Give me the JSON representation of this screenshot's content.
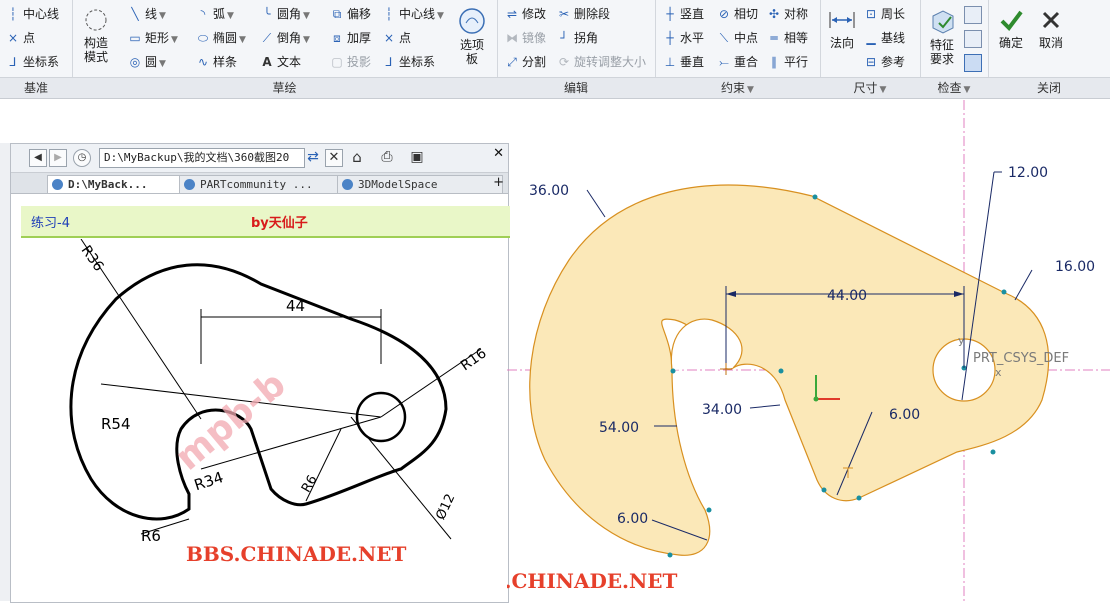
{
  "ribbon": {
    "groups": [
      {
        "label": "基准",
        "items": [
          "中心线",
          "点",
          "坐标系"
        ]
      },
      {
        "label": "草绘",
        "items": [
          "构造模式",
          "线",
          "矩形",
          "圆",
          "弧",
          "椭圆",
          "样条",
          "圆角",
          "倒角",
          "文本",
          "偏移",
          "加厚",
          "投影",
          "中心线",
          "点",
          "坐标系",
          "选项板"
        ]
      },
      {
        "label": "编辑",
        "items": [
          "修改",
          "删除段",
          "镜像",
          "拐角",
          "分割",
          "旋转调整大小"
        ]
      },
      {
        "label": "约束",
        "items": [
          "竖直",
          "相切",
          "对称",
          "水平",
          "中点",
          "相等",
          "垂直",
          "重合",
          "平行"
        ]
      },
      {
        "label": "尺寸",
        "items": [
          "法向",
          "周长",
          "基线",
          "参考"
        ]
      },
      {
        "label": "检查",
        "items": [
          "特征要求"
        ]
      },
      {
        "label": "关闭",
        "items": [
          "确定",
          "取消"
        ]
      }
    ]
  },
  "browser": {
    "address": "D:\\MyBackup\\我的文档\\360截图20",
    "tabs": [
      {
        "label": "D:\\MyBack..."
      },
      {
        "label": "PARTcommunity ..."
      },
      {
        "label": "3DModelSpace"
      }
    ],
    "page_title_left": "练习-4",
    "page_title_right": "by天仙子",
    "drawing_labels": {
      "r36": "R36",
      "r16": "R16",
      "d44": "44",
      "r54": "R54",
      "r34": "R34",
      "r6a": "R6",
      "r6b": "R6",
      "d12": "Ø12",
      "stamp": "mpb-b",
      "watermark": "BBS.CHINADE.NET"
    }
  },
  "cad": {
    "dims": {
      "d36": "36.00",
      "d12": "12.00",
      "d16": "16.00",
      "d44": "44.00",
      "d54": "54.00",
      "d34": "34.00",
      "d6a": "6.00",
      "d6b": "6.00"
    },
    "csys_label": "PRT_CSYS_DEF",
    "axis_y": "y",
    "axis_x": "x",
    "watermark": "BBS.CHINADE.NET"
  },
  "colors": {
    "sketch_fill": "#fbe8b8",
    "sketch_edge": "#d89020",
    "dim_color": "#1a2a66",
    "centerline": "#e080c0",
    "watermark": "#e6402b"
  }
}
